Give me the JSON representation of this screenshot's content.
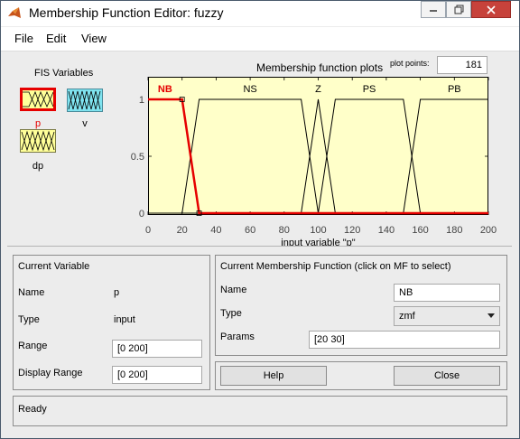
{
  "window": {
    "title": "Membership Function Editor: fuzzy"
  },
  "menu": {
    "items": [
      "File",
      "Edit",
      "View"
    ]
  },
  "fis": {
    "heading": "FIS Variables",
    "variables": [
      {
        "name": "p",
        "color": "#e60000",
        "selected": true
      },
      {
        "name": "v",
        "color": "#000000",
        "selected": false
      },
      {
        "name": "dp",
        "color": "#000000",
        "selected": false
      }
    ]
  },
  "plot": {
    "title": "Membership function plots",
    "plot_points_label": "plot points:",
    "plot_points_value": "181"
  },
  "chart_data": {
    "type": "line",
    "title": "Membership function plots",
    "xlabel": "input variable \"p\"",
    "ylabel": "",
    "xlim": [
      0,
      200
    ],
    "ylim": [
      0,
      1
    ],
    "xticks": [
      "0",
      "20",
      "40",
      "60",
      "80",
      "100",
      "120",
      "140",
      "160",
      "180",
      "200"
    ],
    "yticks": [
      "0",
      "0.5",
      "1"
    ],
    "mf_labels": [
      "NB",
      "NS",
      "Z",
      "PS",
      "PB"
    ],
    "selected_mf": "NB",
    "selected_color": "#e60000",
    "series": [
      {
        "name": "NB",
        "x": [
          0,
          20,
          30,
          200
        ],
        "y": [
          1,
          1,
          0,
          0
        ],
        "selected": true
      },
      {
        "name": "NS",
        "x": [
          0,
          20,
          30,
          90,
          100,
          200
        ],
        "y": [
          0,
          0,
          1,
          1,
          0,
          0
        ]
      },
      {
        "name": "Z",
        "x": [
          0,
          90,
          100,
          110,
          200
        ],
        "y": [
          0,
          0,
          1,
          0,
          0
        ]
      },
      {
        "name": "PS",
        "x": [
          0,
          100,
          110,
          150,
          160,
          200
        ],
        "y": [
          0,
          0,
          1,
          1,
          0,
          0
        ]
      },
      {
        "name": "PB",
        "x": [
          0,
          150,
          160,
          200
        ],
        "y": [
          0,
          0,
          1,
          1
        ]
      }
    ]
  },
  "current_variable": {
    "heading": "Current Variable",
    "name_label": "Name",
    "name_value": "p",
    "type_label": "Type",
    "type_value": "input",
    "range_label": "Range",
    "range_value": "[0 200]",
    "display_range_label": "Display Range",
    "display_range_value": "[0 200]"
  },
  "current_mf": {
    "heading": "Current Membership Function (click on MF to select)",
    "name_label": "Name",
    "name_value": "NB",
    "type_label": "Type",
    "type_value": "zmf",
    "params_label": "Params",
    "params_value": "[20 30]"
  },
  "buttons": {
    "help": "Help",
    "close": "Close"
  },
  "status": {
    "text": "Ready"
  }
}
